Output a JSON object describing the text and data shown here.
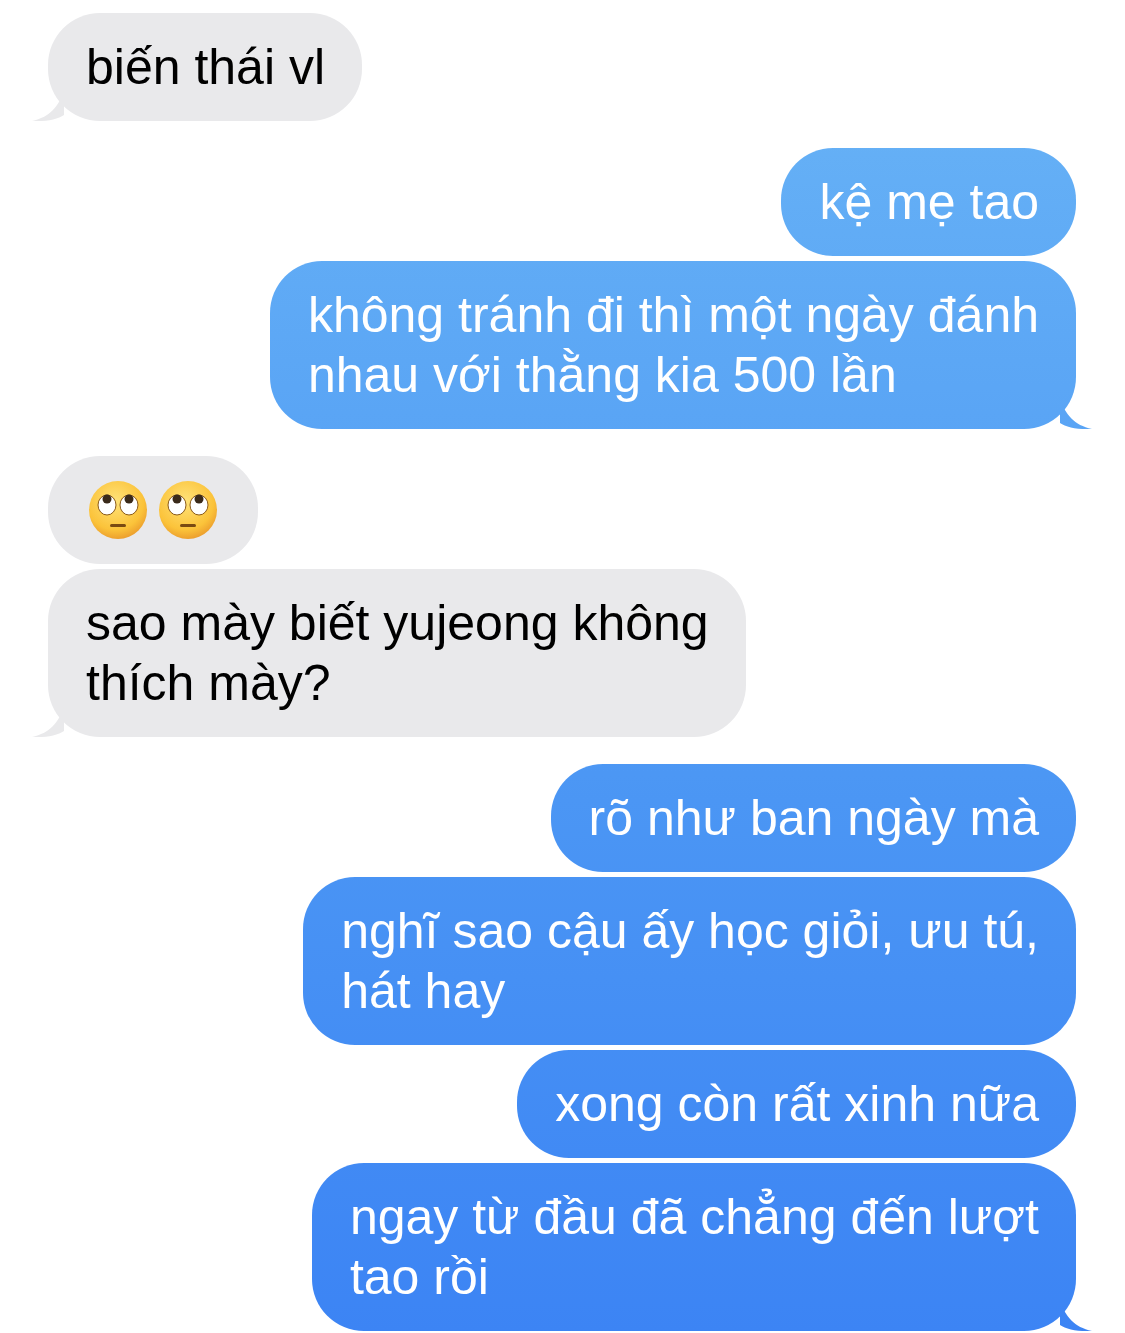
{
  "messages": [
    {
      "sent": false,
      "kind": "text",
      "lines": [
        "biến thái vl"
      ],
      "tail": true
    },
    {
      "sent": true,
      "kind": "text",
      "lines": [
        "kệ mẹ tao"
      ],
      "tail": false
    },
    {
      "sent": true,
      "kind": "text",
      "lines": [
        "không tránh đi thì một ngày đánh",
        "nhau với thằng kia 500 lần"
      ],
      "tail": true
    },
    {
      "sent": false,
      "kind": "emoji",
      "tail": false
    },
    {
      "sent": false,
      "kind": "text",
      "lines": [
        "sao mày biết yujeong không",
        "thích mày?"
      ],
      "tail": true
    },
    {
      "sent": true,
      "kind": "text",
      "lines": [
        "rõ như ban ngày mà"
      ],
      "tail": false
    },
    {
      "sent": true,
      "kind": "text",
      "lines": [
        "nghĩ sao cậu ấy học giỏi, ưu tú,",
        "hát hay"
      ],
      "tail": false
    },
    {
      "sent": true,
      "kind": "text",
      "lines": [
        "xong còn rất xinh nữa"
      ],
      "tail": false
    },
    {
      "sent": true,
      "kind": "text",
      "lines": [
        "ngay từ đầu đã chẳng đến lượt",
        "tao rồi"
      ],
      "tail": true
    }
  ]
}
